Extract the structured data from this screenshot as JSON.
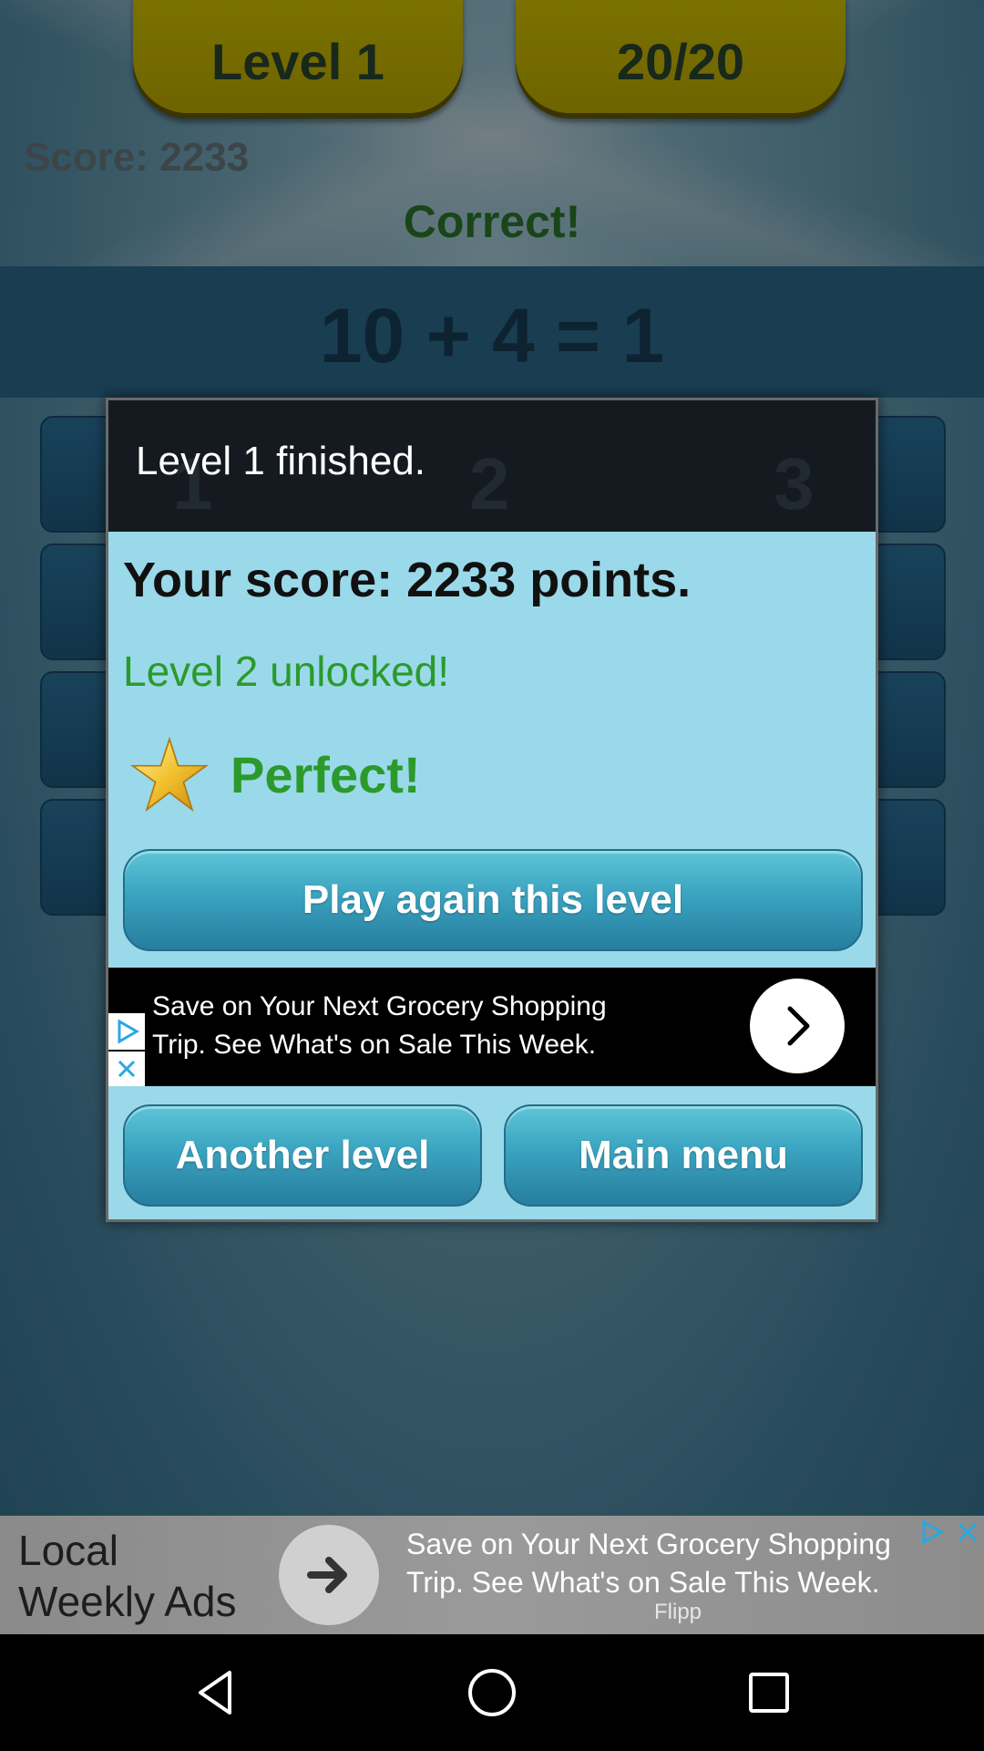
{
  "game": {
    "level_tab": "Level 1",
    "progress_tab": "20/20",
    "score": "Score: 2233",
    "feedback": "Correct!",
    "equation": "10 + 4 = 1",
    "answers": [
      "1",
      "2",
      "3"
    ]
  },
  "dialog": {
    "title": "Level 1 finished.",
    "score_text": "Your score: 2233 points.",
    "unlocked_text": "Level 2 unlocked!",
    "perfect_text": "Perfect!",
    "play_again_label": "Play again this level",
    "another_level_label": "Another level",
    "main_menu_label": "Main menu",
    "ad": {
      "text": "Save on Your Next Grocery Shopping Trip. See What's on Sale This Week."
    }
  },
  "banner_ad": {
    "left_text": "Local Weekly Ads on Flipp",
    "right_text": "Save on Your Next Grocery Shopping Trip. See What's on Sale This Week.",
    "brand": "Flipp"
  },
  "colors": {
    "tab_yellow": "#d8c800",
    "accent_green": "#2b9a2b",
    "dialog_bg": "#9ad9e9",
    "button_teal": "#3aa3bf"
  },
  "icons": [
    "star-icon",
    "adchoices-icon",
    "close-icon",
    "chevron-right-icon",
    "arrow-right-icon",
    "back-icon",
    "home-icon",
    "recents-icon"
  ]
}
